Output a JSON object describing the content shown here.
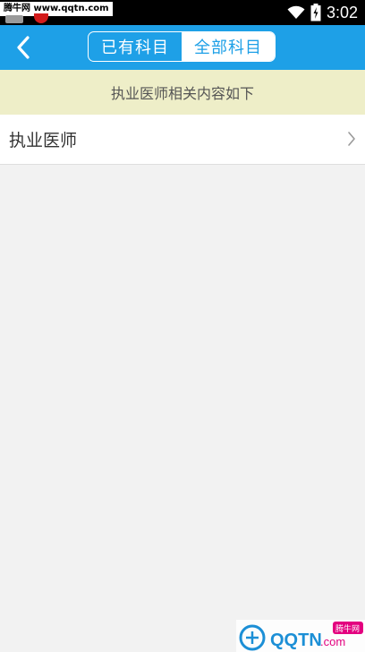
{
  "status_bar": {
    "watermark_text": "腾牛网 www.qqtn.com",
    "time": "3:02",
    "icons": [
      "wifi-icon",
      "battery-icon"
    ]
  },
  "header": {
    "back_icon": "chevron-left-icon",
    "tabs": [
      {
        "label": "已有科目",
        "active": false
      },
      {
        "label": "全部科目",
        "active": true
      }
    ],
    "bg_color": "#1ea0e7"
  },
  "notice": {
    "text": "执业医师相关内容如下",
    "bg_color": "#eeeec8"
  },
  "list": {
    "items": [
      {
        "label": "执业医师",
        "icon": "chevron-right-icon"
      }
    ]
  },
  "footer_watermark": {
    "logo_text": "QQTN",
    "suffix": ".com",
    "badge": "腾牛网"
  }
}
